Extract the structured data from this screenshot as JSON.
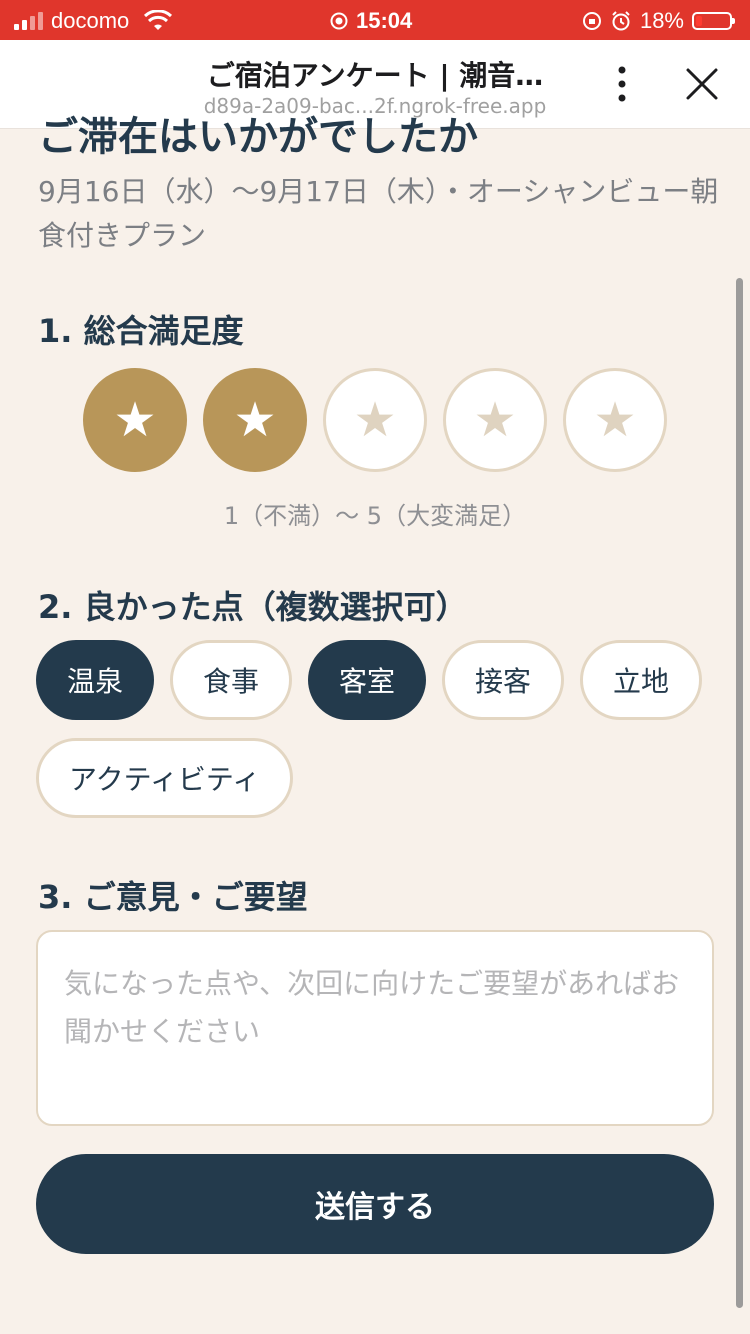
{
  "status_bar": {
    "carrier": "docomo",
    "time": "15:04",
    "battery_percent": "18%",
    "battery_level": 0.18
  },
  "browser": {
    "title": "ご宿泊アンケート | 潮音…",
    "url": "d89a-2a09-bac...2f.ngrok-free.app"
  },
  "page": {
    "heading": "ご滞在はいかがでしたか",
    "stay_info": "9月16日（水）〜9月17日（木）・オーシャンビュー朝食付きプラン"
  },
  "q1": {
    "title": "1. 総合満足度",
    "rating": 2,
    "max": 5,
    "star_glyph": "★",
    "scale_note": "1（不満）〜 5（大変満足）"
  },
  "q2": {
    "title": "2. 良かった点（複数選択可）",
    "options": [
      {
        "label": "温泉",
        "selected": true
      },
      {
        "label": "食事",
        "selected": false
      },
      {
        "label": "客室",
        "selected": true
      },
      {
        "label": "接客",
        "selected": false
      },
      {
        "label": "立地",
        "selected": false
      },
      {
        "label": "アクティビティ",
        "selected": false
      }
    ]
  },
  "q3": {
    "title": "3. ご意見・ご要望",
    "placeholder": "気になった点や、次回に向けたご要望があればお聞かせください"
  },
  "submit_label": "送信する",
  "colors": {
    "status_bar": "#e0362c",
    "background": "#f8f1ea",
    "navy": "#233a4c",
    "gold": "#b89659",
    "border": "#e3d6c2"
  }
}
